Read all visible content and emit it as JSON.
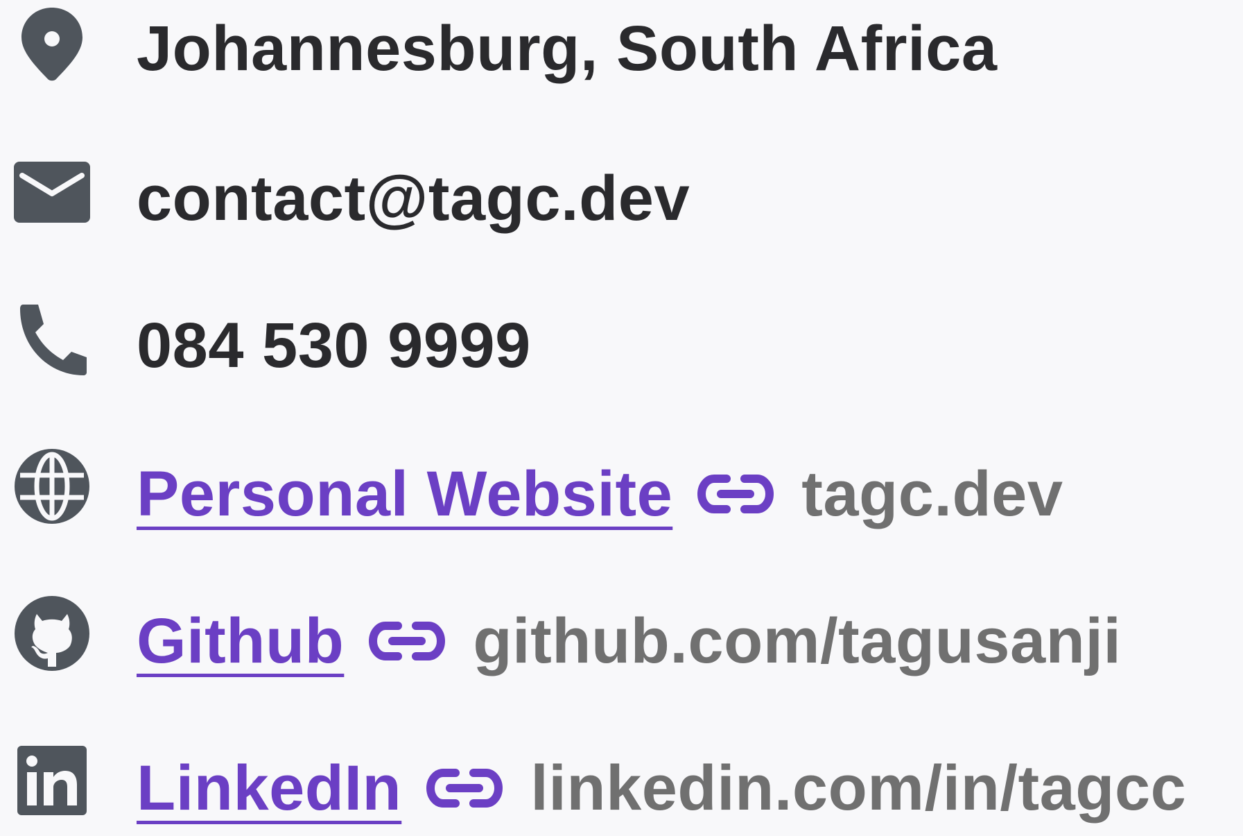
{
  "contact": {
    "location": "Johannesburg, South Africa",
    "email": "contact@tagc.dev",
    "phone": "084 530 9999",
    "links": [
      {
        "label": "Personal Website",
        "url": "tagc.dev",
        "icon": "globe-icon"
      },
      {
        "label": "Github",
        "url": "github.com/tagusanji",
        "icon": "github-icon"
      },
      {
        "label": "LinkedIn",
        "url": "linkedin.com/in/tagcc",
        "icon": "linkedin-icon"
      }
    ]
  },
  "icons": {
    "location": "map-pin-icon",
    "email": "envelope-icon",
    "phone": "phone-icon",
    "link": "chain-link-icon"
  },
  "colors": {
    "text": "#2a2a2d",
    "icon": "#4f555c",
    "link": "#6b3fc4",
    "url": "#707070",
    "background": "#f8f8fa"
  }
}
